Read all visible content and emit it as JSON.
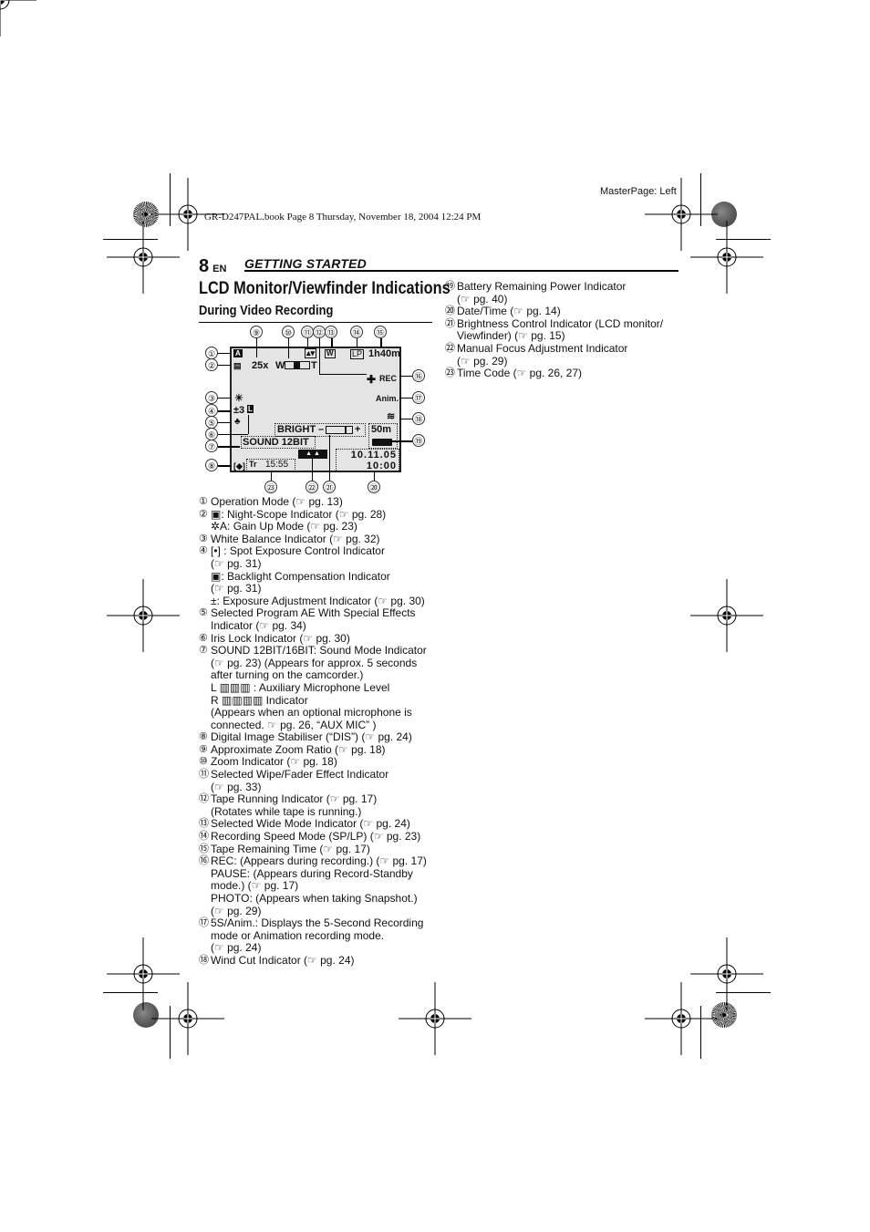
{
  "print_marks": {
    "master_page": "MasterPage: Left",
    "book_line": "GR-D247PAL.book  Page 8  Thursday, November 18, 2004  12:24 PM"
  },
  "header": {
    "page_number": "8",
    "language": "EN",
    "section": "GETTING STARTED"
  },
  "title": "LCD Monitor/Viewfinder Indications",
  "subtitle": "During Video Recording",
  "lcd": {
    "zoom_ratio": "25x",
    "zoom_w": "W",
    "zoom_t": "T",
    "zoom_position_fraction": 0.5,
    "wide_mode": "W",
    "speed_mode": "LP",
    "tape_remaining": "1h40m",
    "rec": "REC",
    "anim": "Anim.",
    "exposure": "±3",
    "iris_lock": "L",
    "bright_label": "BRIGHT",
    "bright_minus": "–",
    "bright_plus": "+",
    "brightness_fraction": 0.75,
    "battery_time": "50m",
    "sound": "SOUND  12BIT",
    "date": "10.11.05",
    "time": "10:00",
    "timecode": "15:55",
    "callouts_top": [
      "⑨",
      "⑩",
      "⑪",
      "⑫",
      "⑬",
      "⑭",
      "⑮"
    ],
    "callouts_left": [
      "①",
      "②",
      "③",
      "④",
      "⑤",
      "⑥",
      "⑦",
      "⑧"
    ],
    "callouts_right": [
      "⑯",
      "⑰",
      "⑱",
      "⑲"
    ],
    "callouts_bottom": [
      "㉓",
      "㉒",
      "㉑",
      "⑳"
    ]
  },
  "left_list": [
    {
      "num": "①",
      "lines": [
        "Operation Mode (☞ pg. 13)"
      ]
    },
    {
      "num": "②",
      "lines": [
        "▣: Night-Scope Indicator (☞ pg. 28)",
        "✲A: Gain Up Mode (☞ pg. 23)"
      ]
    },
    {
      "num": "③",
      "lines": [
        "White Balance Indicator (☞ pg. 32)"
      ]
    },
    {
      "num": "④",
      "lines": [
        "[•] : Spot Exposure Control Indicator",
        "(☞ pg. 31)",
        "▣: Backlight Compensation Indicator",
        "(☞ pg. 31)",
        "±: Exposure Adjustment Indicator (☞ pg. 30)"
      ]
    },
    {
      "num": "⑤",
      "lines": [
        "Selected Program AE With Special Effects",
        "Indicator (☞ pg. 34)"
      ]
    },
    {
      "num": "⑥",
      "lines": [
        "Iris Lock Indicator (☞ pg. 30)"
      ]
    },
    {
      "num": "⑦",
      "lines": [
        "SOUND 12BIT/16BIT: Sound Mode Indicator",
        "(☞ pg. 23) (Appears for approx. 5 seconds",
        "after turning on the camcorder.)",
        "L ▥▥▥ : Auxiliary Microphone Level",
        "R ▥▥▥▥  Indicator",
        "(Appears when an optional microphone is",
        "connected. ☞ pg. 26, “AUX MIC” )"
      ]
    },
    {
      "num": "⑧",
      "lines": [
        "Digital Image Stabiliser (“DIS”) (☞ pg. 24)"
      ]
    },
    {
      "num": "⑨",
      "lines": [
        "Approximate Zoom Ratio (☞ pg. 18)"
      ]
    },
    {
      "num": "⑩",
      "lines": [
        "Zoom Indicator (☞ pg. 18)"
      ]
    },
    {
      "num": "⑪",
      "lines": [
        "Selected Wipe/Fader Effect Indicator",
        "(☞ pg. 33)"
      ]
    },
    {
      "num": "⑫",
      "lines": [
        "Tape Running Indicator (☞ pg. 17)",
        "(Rotates while tape is running.)"
      ]
    },
    {
      "num": "⑬",
      "lines": [
        "Selected Wide Mode Indicator (☞ pg. 24)"
      ]
    },
    {
      "num": "⑭",
      "lines": [
        "Recording Speed Mode (SP/LP) (☞ pg. 23)"
      ]
    },
    {
      "num": "⑮",
      "lines": [
        "Tape Remaining Time (☞ pg. 17)"
      ]
    },
    {
      "num": "⑯",
      "lines": [
        "REC: (Appears during recording.) (☞ pg. 17)",
        "PAUSE: (Appears during Record-Standby",
        "mode.) (☞ pg. 17)",
        "PHOTO: (Appears when taking Snapshot.)",
        "(☞ pg. 29)"
      ]
    },
    {
      "num": "⑰",
      "lines": [
        "5S/Anim.: Displays the 5-Second Recording",
        "mode or Animation recording mode.",
        "(☞ pg. 24)"
      ]
    },
    {
      "num": "⑱",
      "lines": [
        "Wind Cut Indicator (☞ pg. 24)"
      ]
    }
  ],
  "right_list": [
    {
      "num": "⑲",
      "lines": [
        "Battery Remaining Power Indicator",
        "(☞ pg. 40)"
      ]
    },
    {
      "num": "⑳",
      "lines": [
        "Date/Time (☞ pg. 14)"
      ]
    },
    {
      "num": "㉑",
      "lines": [
        "Brightness Control Indicator (LCD monitor/",
        "Viewfinder) (☞ pg. 15)"
      ]
    },
    {
      "num": "㉒",
      "lines": [
        "Manual Focus Adjustment Indicator",
        "(☞ pg. 29)"
      ]
    },
    {
      "num": "㉓",
      "lines": [
        "Time Code (☞ pg. 26, 27)"
      ]
    }
  ]
}
